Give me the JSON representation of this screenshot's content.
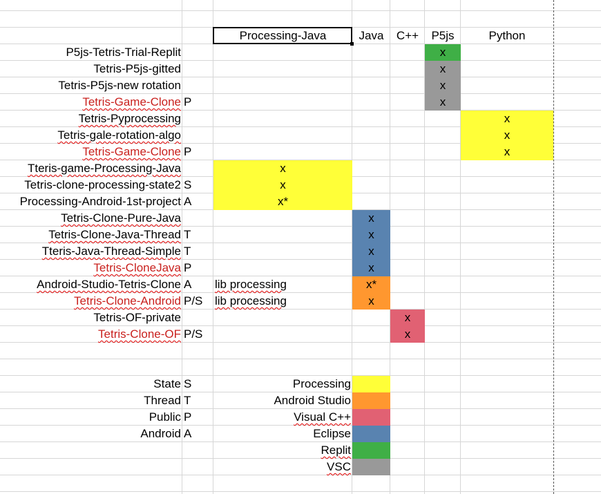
{
  "colors": {
    "processing": "#ffff38",
    "android_studio": "#ff972f",
    "visual_cpp": "#e16173",
    "eclipse": "#5983b0",
    "replit": "#3faf46",
    "vsc": "#999999",
    "red_text": "#c9211e"
  },
  "header": {
    "processing_java": "Processing-Java",
    "java": "Java",
    "cpp": "C++",
    "p5js": "P5js",
    "python": "Python"
  },
  "rows": [
    {
      "name": "P5js-Tetris-Trial-Replit",
      "red": false,
      "wavy": false,
      "flag": "",
      "lib": "",
      "mark": "x",
      "lang": "p5js",
      "tool": "replit"
    },
    {
      "name": "Tetris-P5js-gitted",
      "red": false,
      "wavy": false,
      "flag": "",
      "lib": "",
      "mark": "x",
      "lang": "p5js",
      "tool": "vsc"
    },
    {
      "name": "Tetris-P5js-new rotation",
      "red": false,
      "wavy": false,
      "flag": "",
      "lib": "",
      "mark": "x",
      "lang": "p5js",
      "tool": "vsc"
    },
    {
      "name": "Tetris-Game-Clone",
      "red": true,
      "wavy": true,
      "flag": "P",
      "lib": "",
      "mark": "x",
      "lang": "p5js",
      "tool": "vsc"
    },
    {
      "name": "Tetris-Pyprocessing",
      "red": false,
      "wavy": true,
      "flag": "",
      "lib": "",
      "mark": "x",
      "lang": "python",
      "tool": "processing"
    },
    {
      "name": "Tetris-gale-rotation-algo",
      "red": false,
      "wavy": true,
      "flag": "",
      "lib": "",
      "mark": "x",
      "lang": "python",
      "tool": "processing"
    },
    {
      "name": "Tetris-Game-Clone",
      "red": true,
      "wavy": true,
      "flag": "P",
      "lib": "",
      "mark": "x",
      "lang": "python",
      "tool": "processing"
    },
    {
      "name": "Tteris-game-Processing-Java",
      "red": false,
      "wavy": true,
      "flag": "",
      "lib": "",
      "mark": "x",
      "lang": "processing_java",
      "tool": "processing"
    },
    {
      "name": "Tetris-clone-processing-state2",
      "red": false,
      "wavy": false,
      "flag": "S",
      "lib": "",
      "mark": "x",
      "lang": "processing_java",
      "tool": "processing"
    },
    {
      "name": "Processing-Android-1st-project",
      "red": false,
      "wavy": false,
      "flag": "A",
      "lib": "",
      "mark": "x*",
      "lang": "processing_java",
      "tool": "processing"
    },
    {
      "name": "Tetris-Clone-Pure-Java",
      "red": false,
      "wavy": true,
      "flag": "",
      "lib": "",
      "mark": "x",
      "lang": "java",
      "tool": "eclipse"
    },
    {
      "name": "Tetris-Clone-Java-Thread",
      "red": false,
      "wavy": true,
      "flag": "T",
      "lib": "",
      "mark": "x",
      "lang": "java",
      "tool": "eclipse"
    },
    {
      "name": "Tteris-Java-Thread-Simple",
      "red": false,
      "wavy": true,
      "flag": "T",
      "lib": "",
      "mark": "x",
      "lang": "java",
      "tool": "eclipse"
    },
    {
      "name": "Tetris-CloneJava",
      "red": true,
      "wavy": true,
      "flag": "P",
      "lib": "",
      "mark": "x",
      "lang": "java",
      "tool": "eclipse"
    },
    {
      "name": "Android-Studio-Tetris-Clone",
      "red": false,
      "wavy": true,
      "flag": "A",
      "lib": "lib processing",
      "mark": "x*",
      "lang": "java",
      "tool": "android_studio"
    },
    {
      "name": "Tetris-Clone-Android",
      "red": true,
      "wavy": true,
      "flag": "P/S",
      "lib": "lib processing",
      "mark": "x",
      "lang": "java",
      "tool": "android_studio"
    },
    {
      "name": "Tetris-OF-private",
      "red": false,
      "wavy": false,
      "flag": "",
      "lib": "",
      "mark": "x",
      "lang": "cpp",
      "tool": "visual_cpp"
    },
    {
      "name": "Tetris-Clone-OF",
      "red": true,
      "wavy": true,
      "flag": "P/S",
      "lib": "",
      "mark": "x",
      "lang": "cpp",
      "tool": "visual_cpp"
    }
  ],
  "flag_legend": [
    {
      "label": "State",
      "code": "S"
    },
    {
      "label": "Thread",
      "code": "T"
    },
    {
      "label": "Public",
      "code": "P"
    },
    {
      "label": "Android",
      "code": "A"
    }
  ],
  "tool_legend": [
    {
      "label": "Processing",
      "color_key": "processing",
      "wavy": false
    },
    {
      "label": "Android Studio",
      "color_key": "android_studio",
      "wavy": false
    },
    {
      "label": "Visual C++",
      "color_key": "visual_cpp",
      "wavy": true
    },
    {
      "label": "Eclipse",
      "color_key": "eclipse",
      "wavy": false
    },
    {
      "label": "Replit",
      "color_key": "replit",
      "wavy": true
    },
    {
      "label": "VSC",
      "color_key": "vsc",
      "wavy": true
    }
  ]
}
